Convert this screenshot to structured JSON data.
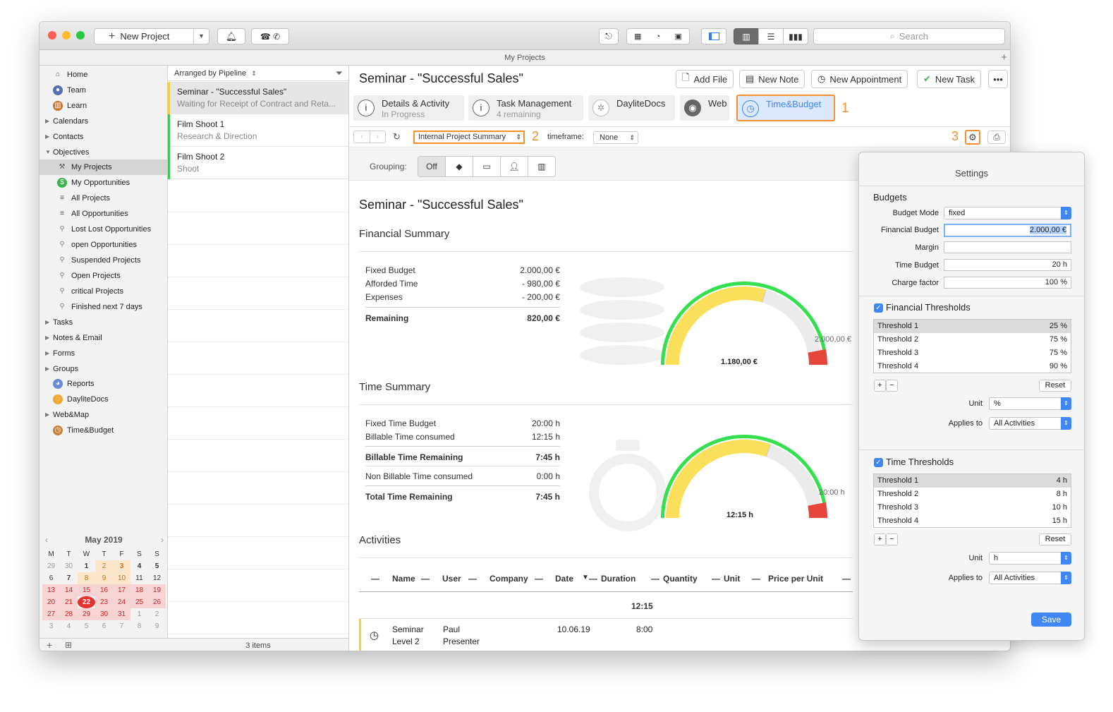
{
  "toolbar": {
    "new_project_label": "New Project",
    "search_placeholder": "Search"
  },
  "window_title": "My Projects",
  "sidebar": {
    "items": [
      {
        "label": "Home",
        "icon": "house-icon"
      },
      {
        "label": "Team",
        "icon": "team-icon"
      },
      {
        "label": "Learn",
        "icon": "books-icon"
      },
      {
        "label": "Calendars",
        "icon": ""
      },
      {
        "label": "Contacts",
        "icon": ""
      },
      {
        "label": "Objectives",
        "icon": ""
      },
      {
        "label": "My Projects",
        "icon": "hammer-icon"
      },
      {
        "label": "My Opportunities",
        "icon": "dollar-icon"
      },
      {
        "label": "All Projects",
        "icon": "list-icon"
      },
      {
        "label": "All Opportunities",
        "icon": "list-icon"
      },
      {
        "label": "Lost Lost Opportunities",
        "icon": "filter-icon"
      },
      {
        "label": "open Opportunities",
        "icon": "filter-icon"
      },
      {
        "label": "Suspended Projects",
        "icon": "filter-icon"
      },
      {
        "label": "Open Projects",
        "icon": "filter-icon"
      },
      {
        "label": "critical Projects",
        "icon": "filter-icon"
      },
      {
        "label": "Finished next 7 days",
        "icon": "filter-icon"
      },
      {
        "label": "Tasks",
        "icon": ""
      },
      {
        "label": "Notes & Email",
        "icon": ""
      },
      {
        "label": "Forms",
        "icon": ""
      },
      {
        "label": "Groups",
        "icon": ""
      },
      {
        "label": "Reports",
        "icon": "reports-icon"
      },
      {
        "label": "DayliteDocs",
        "icon": "docs-icon"
      },
      {
        "label": "Web&Map",
        "icon": "map-icon"
      },
      {
        "label": "Time&Budget",
        "icon": "budget-icon"
      }
    ],
    "calendar": {
      "month": "May 2019",
      "weekdays": [
        "M",
        "T",
        "W",
        "T",
        "F",
        "S",
        "S"
      ],
      "days": [
        "29",
        "30",
        "1",
        "2",
        "3",
        "4",
        "5",
        "6",
        "7",
        "8",
        "9",
        "10",
        "11",
        "12",
        "13",
        "14",
        "15",
        "16",
        "17",
        "18",
        "19",
        "20",
        "21",
        "22",
        "23",
        "24",
        "25",
        "26",
        "27",
        "28",
        "29",
        "30",
        "31",
        "1",
        "2",
        "3",
        "4",
        "5",
        "6",
        "7",
        "8",
        "9"
      ]
    }
  },
  "list": {
    "header": "Arranged by Pipeline",
    "rows": [
      {
        "title": "Seminar - \"Successful Sales\"",
        "subtitle": "Waiting for Receipt of Contract and Reta...",
        "color": "#f2d43a"
      },
      {
        "title": "Film Shoot 1",
        "subtitle": "Research & Direction",
        "color": "#3ec84b"
      },
      {
        "title": "Film Shoot 2",
        "subtitle": "Shoot",
        "color": "#3ec84b"
      }
    ],
    "footer": "3 items"
  },
  "main": {
    "title": "Seminar - \"Successful Sales\"",
    "buttons": {
      "add_file": "Add File",
      "new_note": "New Note",
      "new_appointment": "New Appointment",
      "new_task": "New Task"
    },
    "tabs": [
      {
        "label": "Details & Activity",
        "sub": "In Progress"
      },
      {
        "label": "Task Management",
        "sub": "4 remaining"
      },
      {
        "label": "DayliteDocs",
        "sub": ""
      },
      {
        "label": "Web",
        "sub": ""
      },
      {
        "label": "Time&Budget",
        "sub": ""
      }
    ],
    "markers": [
      "1",
      "2",
      "3"
    ],
    "report_select": "Internal Project Summary",
    "timeframe_label": "timeframe:",
    "timeframe_value": "None",
    "grouping_label": "Grouping:",
    "grouping_off": "Off",
    "report_title": "Seminar - \"Successful Sales\"",
    "financial": {
      "heading": "Financial Summary",
      "rows": [
        {
          "label": "Fixed Budget",
          "value": "2.000,00 €"
        },
        {
          "label": "Afforded Time",
          "value": "- 980,00 €"
        },
        {
          "label": "Expenses",
          "value": "- 200,00 €"
        }
      ],
      "remaining_label": "Remaining",
      "remaining_value": "820,00 €",
      "gauge_value": "1.180,00 €",
      "gauge_max": "2.000,00 €",
      "gauge_fraction": 0.59
    },
    "time": {
      "heading": "Time Summary",
      "rows1": [
        {
          "label": "Fixed Time Budget",
          "value": "20:00 h"
        },
        {
          "label": "Billable Time consumed",
          "value": "12:15 h"
        }
      ],
      "billable_remaining_label": "Billable Time Remaining",
      "billable_remaining_value": "7:45 h",
      "nonbillable_label": "Non Billable Time consumed",
      "nonbillable_value": "0:00 h",
      "total_label": "Total Time Remaining",
      "total_value": "7:45 h",
      "gauge_value": "12:15 h",
      "gauge_max": "20:00 h",
      "gauge_fraction": 0.61
    },
    "activities": {
      "heading": "Activities",
      "columns": [
        "Name",
        "User",
        "Company",
        "Date",
        "Duration",
        "Quantity",
        "Unit",
        "Price per Unit"
      ],
      "total_duration": "12:15",
      "row": {
        "name1": "Seminar",
        "name2": "Level 2",
        "user1": "Paul",
        "user2": "Presenter",
        "date": "10.06.19",
        "duration": "8:00"
      }
    }
  },
  "settings": {
    "title": "Settings",
    "budgets_heading": "Budgets",
    "budget_mode_label": "Budget Mode",
    "budget_mode_value": "fixed",
    "financial_budget_label": "Financial Budget",
    "financial_budget_value": "2.000,00 €",
    "margin_label": "Margin",
    "margin_value": "",
    "time_budget_label": "Time Budget",
    "time_budget_value": "20 h",
    "charge_factor_label": "Charge factor",
    "charge_factor_value": "100 %",
    "fin_thresholds_heading": "Financial Thresholds",
    "fin_thresholds": [
      {
        "name": "Threshold 1",
        "value": "25 %"
      },
      {
        "name": "Threshold 2",
        "value": "75 %"
      },
      {
        "name": "Threshold 3",
        "value": "75 %"
      },
      {
        "name": "Threshold 4",
        "value": "90 %"
      }
    ],
    "reset_label": "Reset",
    "unit_label": "Unit",
    "fin_unit_value": "%",
    "applies_label": "Applies to",
    "fin_applies_value": "All Activities",
    "time_thresholds_heading": "Time Thresholds",
    "time_thresholds": [
      {
        "name": "Threshold 1",
        "value": "4 h"
      },
      {
        "name": "Threshold 2",
        "value": "8 h"
      },
      {
        "name": "Threshold 3",
        "value": "10 h"
      },
      {
        "name": "Threshold 4",
        "value": "15 h"
      }
    ],
    "time_unit_value": "h",
    "time_applies_value": "All Activities",
    "save_label": "Save"
  },
  "colors": {
    "accent": "#3f87f5",
    "orange": "#f4902d",
    "gauge_fill": "#fadf5a",
    "gauge_ring": "#35e04f",
    "gauge_end": "#e5453a"
  }
}
